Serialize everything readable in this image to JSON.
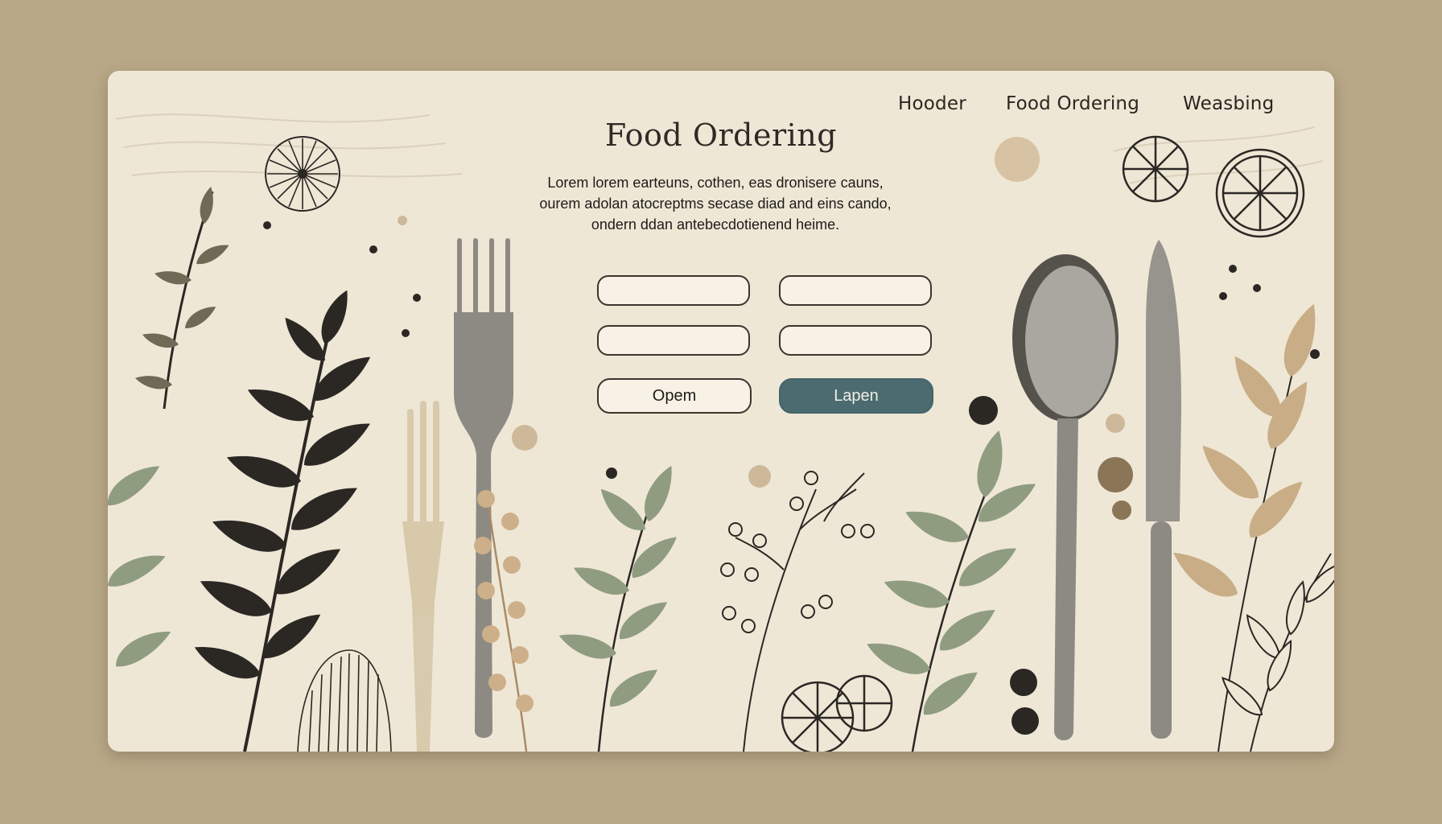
{
  "header": {
    "nav": [
      "Hooder",
      "Food Ordering",
      "Weasbing"
    ]
  },
  "main": {
    "title": "Food Ordering",
    "intro_lines": [
      "Lorem lorem earteuns, cothen, eas dronisere cauns,",
      "ourem adolan atocreptms secase diad and eins cando,",
      "ondern ddan antebecdotienend heime."
    ]
  },
  "form": {
    "fields": [
      {
        "value": "",
        "placeholder": ""
      },
      {
        "value": "",
        "placeholder": ""
      },
      {
        "value": "",
        "placeholder": ""
      },
      {
        "value": "",
        "placeholder": ""
      }
    ],
    "buttons": {
      "open_label": "Opem",
      "login_label": "Lapen"
    }
  },
  "theme": {
    "background": "#b8a888",
    "card": "#efe7d6",
    "accent_button": "#4b6b70",
    "leaf_dark": "#2b2824",
    "leaf_sage": "#8f9c80",
    "leaf_tan": "#c8ad86"
  },
  "icons": [
    "fork-icon",
    "spoon-icon",
    "knife-icon",
    "flower-icon",
    "citrus-slice-icon",
    "leaf-branch-icon"
  ]
}
